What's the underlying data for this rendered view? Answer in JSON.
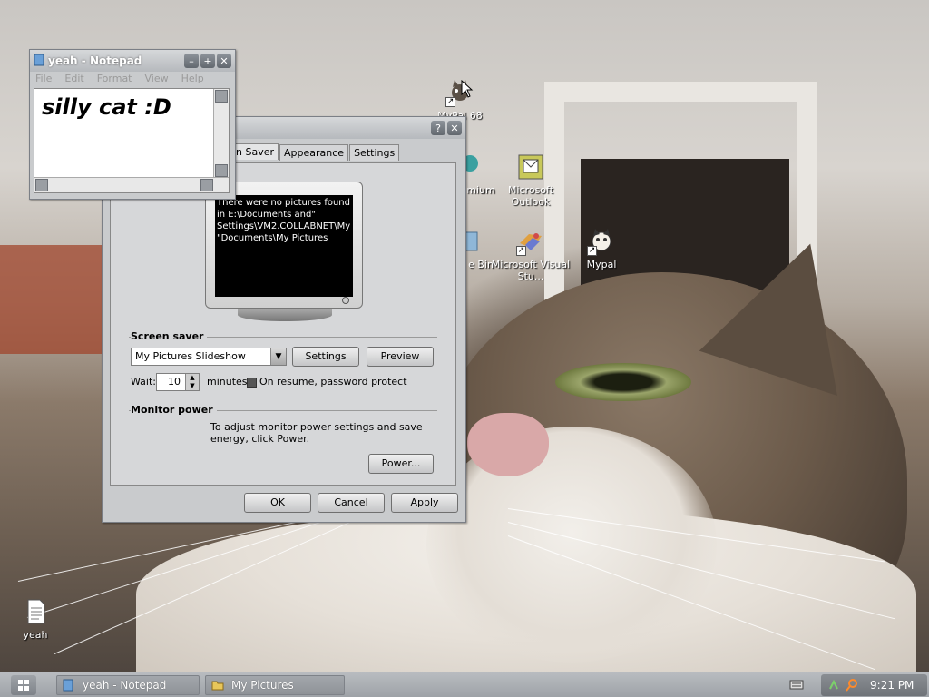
{
  "desktop": {
    "icons": [
      {
        "id": "mypal68",
        "label": "MyPal 68",
        "icon": "mypal-cat-icon",
        "shortcut": true
      },
      {
        "id": "outlook",
        "label": "Microsoft Outlook",
        "icon": "outlook-icon",
        "shortcut": false
      },
      {
        "id": "mypal",
        "label": "Mypal",
        "icon": "mypal-cat-icon",
        "shortcut": true
      },
      {
        "id": "vstudio",
        "label": "Microsoft Visual Stu...",
        "icon": "visual-studio-icon",
        "shortcut": true
      },
      {
        "id": "chromium_partial",
        "label": "mium",
        "icon": "chromium-icon",
        "shortcut": false
      },
      {
        "id": "recycle_partial",
        "label": "e Bin",
        "icon": "recycle-bin-icon",
        "shortcut": false
      },
      {
        "id": "yeah",
        "label": "yeah",
        "icon": "text-file-icon",
        "shortcut": false
      }
    ]
  },
  "notepad": {
    "title": "yeah - Notepad",
    "menu": [
      "File",
      "Edit",
      "Format",
      "View",
      "Help"
    ],
    "content": "silly cat :D"
  },
  "display_properties": {
    "tabs": [
      "n Saver",
      "Appearance",
      "Settings"
    ],
    "active_tab": "n Saver",
    "preview_message": "There were no pictures found in E:\\Documents and\" Settings\\VM2.COLLABNET\\My \"Documents\\My Pictures",
    "screen_saver": {
      "group_label": "Screen saver",
      "selected": "My Pictures Slideshow",
      "settings_label": "Settings",
      "preview_label": "Preview",
      "wait_label": "Wait:",
      "wait_value": "10",
      "wait_unit": "minutes",
      "password_label": "On resume, password protect",
      "password_checked": true
    },
    "monitor_power": {
      "group_label": "Monitor power",
      "description": "To adjust monitor power settings and save energy, click Power.",
      "power_label": "Power..."
    },
    "buttons": {
      "ok": "OK",
      "cancel": "Cancel",
      "apply": "Apply"
    }
  },
  "taskbar": {
    "tasks": [
      {
        "label": "yeah - Notepad",
        "icon": "notepad-icon"
      },
      {
        "label": "My Pictures",
        "icon": "folder-icon"
      }
    ],
    "clock": "9:21 PM"
  }
}
